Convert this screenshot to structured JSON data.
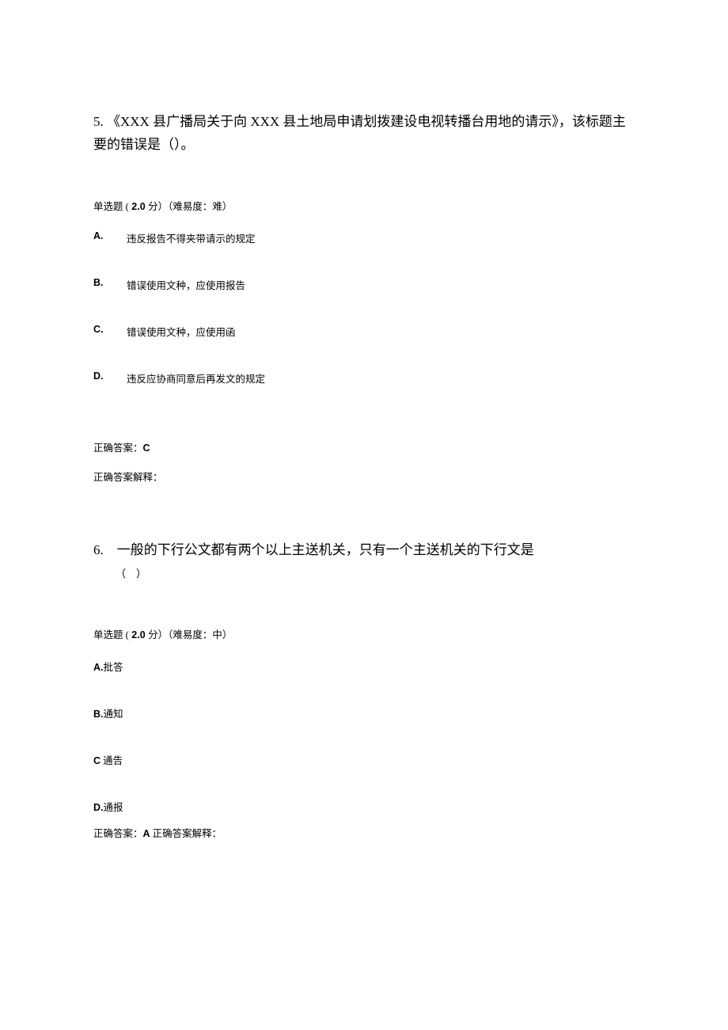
{
  "q1": {
    "number": "5.",
    "text": "《XXX 县广播局关于向 XXX 县土地局申请划拨建设电视转播台用地的请示》，该标题主要的错误是（）。",
    "meta_prefix": "单选题 (",
    "points": " 2.0 ",
    "meta_mid": "分）（难易度：难）",
    "options": {
      "A": {
        "letter": "A.",
        "text": "违反报告不得夹带请示的规定"
      },
      "B": {
        "letter": "B.",
        "text": "错误使用文种，应使用报告"
      },
      "C": {
        "letter": "C.",
        "text": "错误使用文种，应使用函"
      },
      "D": {
        "letter": "D.",
        "text": "违反应协商同意后再发文的规定"
      }
    },
    "answer_label": "正确答案：",
    "answer": "C",
    "explain_label": "正确答案解释："
  },
  "q2": {
    "number": "6.",
    "text": "一般的下行公文都有两个以上主送机关，只有一个主送机关的下行文是",
    "paren": "（　）",
    "meta_prefix": "单选题 (",
    "points": " 2.0 ",
    "meta_mid": "分）（难易度：中）",
    "options": {
      "A": {
        "letter": "A.",
        "text": "批答"
      },
      "B": {
        "letter": "B.",
        "text": "通知"
      },
      "C": {
        "letter": "C",
        "text": " 通告"
      },
      "D": {
        "letter": "D.",
        "text": "通报"
      }
    },
    "answer_label": "正确答案：",
    "answer": "A",
    "explain_label": " 正确答案解释："
  }
}
